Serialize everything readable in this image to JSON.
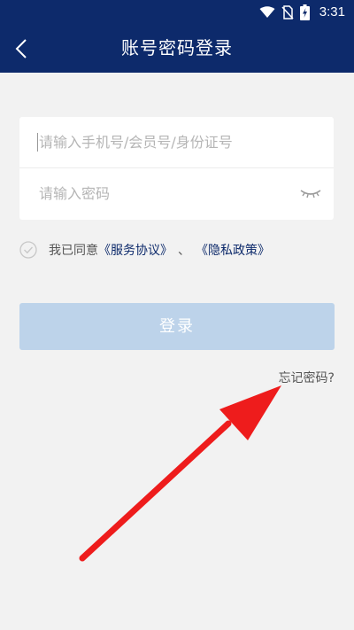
{
  "status_bar": {
    "time": "3:31",
    "icons": [
      "wifi-icon",
      "no-sim-icon",
      "battery-charging-icon"
    ]
  },
  "app_bar": {
    "title": "账号密码登录",
    "back_icon": "chevron-left-icon"
  },
  "form": {
    "account": {
      "placeholder": "请输入手机号/会员号/身份证号",
      "value": ""
    },
    "password": {
      "placeholder": "请输入密码",
      "value": ""
    },
    "eye_icon": "eye-closed-icon"
  },
  "agreement": {
    "prefix": "我已同意",
    "service_link": "《服务协议》",
    "separator": "、",
    "privacy_link": "《隐私政策》",
    "checked": false
  },
  "login_button": {
    "label": "登录",
    "enabled": false
  },
  "forgot_password": {
    "label": "忘记密码?"
  },
  "colors": {
    "header": "#0d2a6b",
    "background": "#f2f2f2",
    "button_disabled": "#bdd3ea",
    "link": "#0d2a6b",
    "annotation_arrow": "#ee1c1c"
  }
}
